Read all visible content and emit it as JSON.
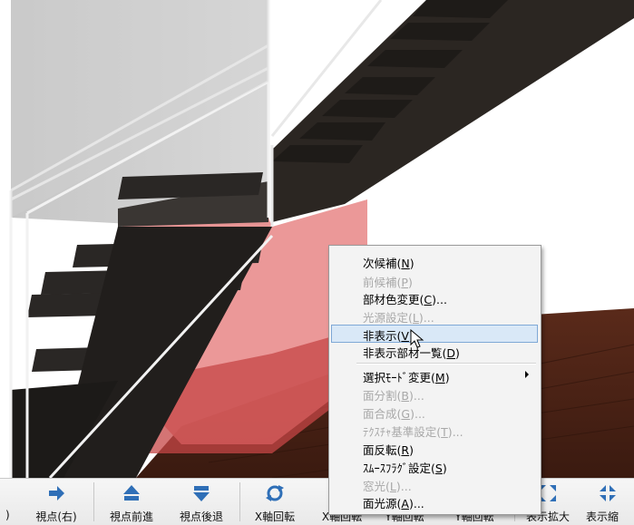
{
  "toolbar": {
    "items": [
      {
        "label": ")",
        "icon": "partial-icon"
      },
      {
        "label": "視点(右)",
        "icon": "arrow-right-icon"
      },
      {
        "label": "視点前進",
        "icon": "arrow-up-icon"
      },
      {
        "label": "視点後退",
        "icon": "arrow-down-icon"
      },
      {
        "label": "X軸回転",
        "icon": "rotate-x-icon"
      },
      {
        "label": "X軸回転",
        "icon": "rotate-x-icon"
      },
      {
        "label": "Y軸回転",
        "icon": "rotate-y-icon"
      },
      {
        "label": "Y軸回転",
        "icon": "rotate-y-icon"
      },
      {
        "label": "表示拡大",
        "icon": "zoom-in-icon"
      },
      {
        "label": "表示縮",
        "icon": "zoom-out-icon"
      }
    ]
  },
  "context_menu": {
    "items": [
      {
        "label": "次候補",
        "key": "N",
        "suffix": "",
        "enabled": true
      },
      {
        "label": "前候補",
        "key": "P",
        "suffix": "",
        "enabled": false
      },
      {
        "label": "部材色変更",
        "key": "C",
        "suffix": "...",
        "enabled": true
      },
      {
        "label": "光源設定",
        "key": "L",
        "suffix": "...",
        "enabled": false
      },
      {
        "label": "非表示",
        "key": "V",
        "suffix": "",
        "enabled": true,
        "highlighted": true
      },
      {
        "label": "非表示部材一覧",
        "key": "D",
        "suffix": "",
        "enabled": true
      },
      {
        "label": "選択ﾓｰﾄﾞ変更",
        "key": "M",
        "suffix": "",
        "enabled": true,
        "submenu": true
      },
      {
        "label": "面分割",
        "key": "B",
        "suffix": "...",
        "enabled": false
      },
      {
        "label": "面合成",
        "key": "G",
        "suffix": "...",
        "enabled": false
      },
      {
        "label": "ﾃｸｽﾁｬ基準設定",
        "key": "T",
        "suffix": "...",
        "enabled": false
      },
      {
        "label": "面反転",
        "key": "R",
        "suffix": "",
        "enabled": true
      },
      {
        "label": "ｽﾑｰｽﾌﾗｸﾞ設定",
        "key": "S",
        "suffix": "",
        "enabled": true
      },
      {
        "label": "窓光",
        "key": "L",
        "suffix": "...",
        "enabled": false
      },
      {
        "label": "面光源",
        "key": "A",
        "suffix": "...",
        "enabled": true
      }
    ]
  },
  "colors": {
    "floor": "#4a2418",
    "wall_pink": "#e47a7a",
    "tread": "#262320",
    "highlight_bg": "#d9e8f7",
    "icon_blue": "#2f6fb7"
  }
}
